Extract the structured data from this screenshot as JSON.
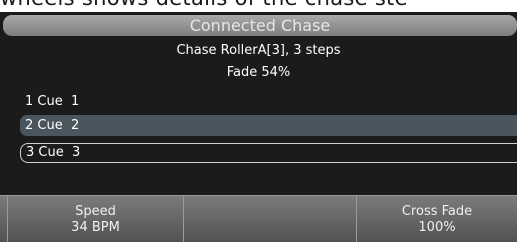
{
  "top_text": "wheels shows details of the chase ste",
  "title": "Connected Chase",
  "info": {
    "chase": "Chase RollerA[3], 3 steps",
    "fade": "Fade 54%"
  },
  "steps": [
    {
      "num": "1",
      "label": "Cue",
      "cue": "1"
    },
    {
      "num": "2",
      "label": "Cue",
      "cue": "2"
    },
    {
      "num": "3",
      "label": "Cue",
      "cue": "3"
    }
  ],
  "buttons": {
    "speed": {
      "title": "Speed",
      "value": "34 BPM"
    },
    "cross_fade": {
      "title": "Cross Fade",
      "value": "100%"
    }
  }
}
